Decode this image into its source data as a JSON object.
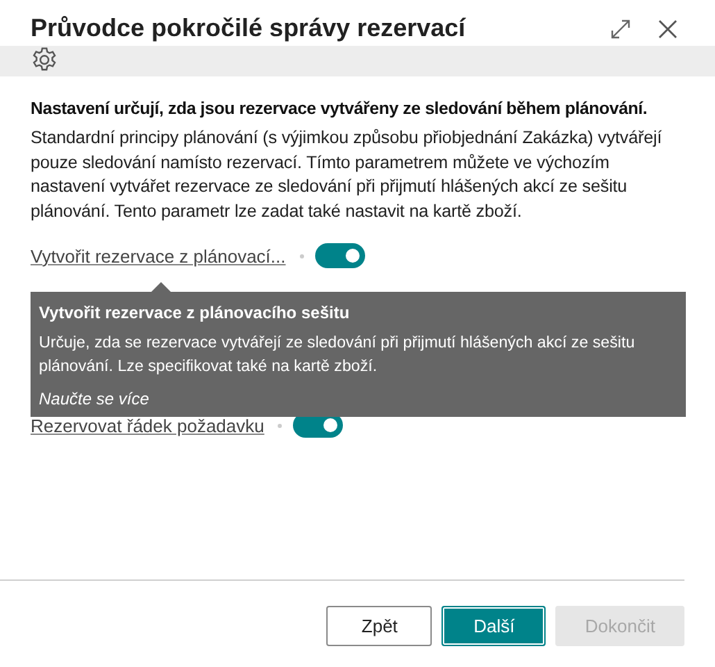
{
  "window": {
    "title": "Průvodce pokročilé správy rezervací"
  },
  "intro": {
    "heading": "Nastavení určují, zda jsou rezervace vytvářeny ze sledování během plánování.",
    "text": "Standardní principy plánování (s výjimkou způsobu přiobjednání Zakázka) vytvářejí pouze sledování namísto rezervací. Tímto parametrem můžete ve výchozím nastavení vytvářet rezervace ze sledování při přijmutí hlášených akcí ze sešitu plánování. Tento parametr lze zadat také nastavit na kartě zboží."
  },
  "fields": [
    {
      "label": "Vytvořit rezervace z plánovací...",
      "on": true
    },
    {
      "label": "Rezervovat řádek požadavku",
      "on": true
    }
  ],
  "tooltip": {
    "title": "Vytvořit rezervace z plánovacího sešitu",
    "text": "Určuje, zda se rezervace vytvářejí ze sledování při přijmutí hlášených akcí ze sešitu plánování. Lze specifikovat také na kartě zboží.",
    "link": "Naučte se více"
  },
  "buttons": [
    {
      "label": "Zpět",
      "kind": "secondary"
    },
    {
      "label": "Další",
      "kind": "primary"
    },
    {
      "label": "Dokončit",
      "kind": "disabled"
    }
  ]
}
